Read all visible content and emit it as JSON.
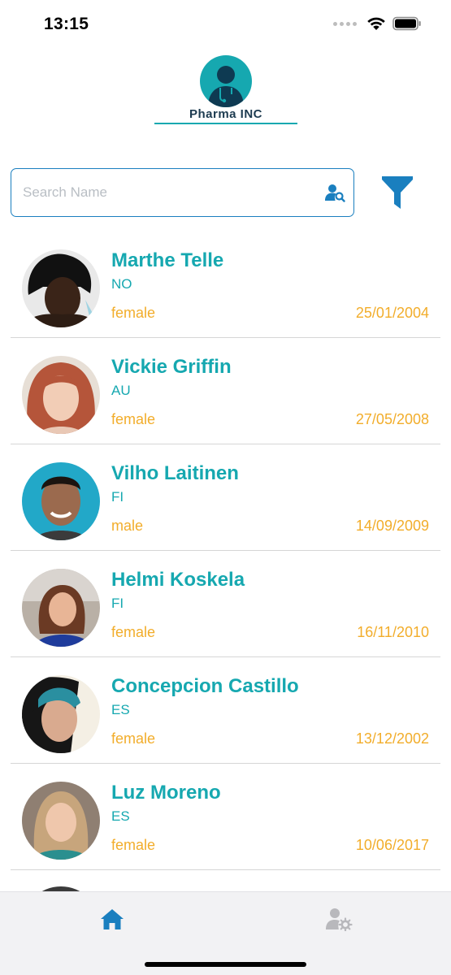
{
  "status_bar": {
    "time": "13:15",
    "icons": [
      "signal-dots-icon",
      "wifi-icon",
      "battery-icon"
    ]
  },
  "logo": {
    "text": "Pharma INC",
    "icon": "doctor-avatar-icon",
    "accent_color": "#16a8b0"
  },
  "search": {
    "value": "",
    "placeholder": "Search Name",
    "icon": "user-search-icon",
    "border_color": "#1a7fbf"
  },
  "filter": {
    "icon": "filter-icon",
    "color": "#1a7fbf"
  },
  "patients": [
    {
      "name": "Marthe Telle",
      "nat": "NO",
      "gender": "female",
      "dob": "25/01/2004"
    },
    {
      "name": "Vickie Griffin",
      "nat": "AU",
      "gender": "female",
      "dob": "27/05/2008"
    },
    {
      "name": "Vilho Laitinen",
      "nat": "FI",
      "gender": "male",
      "dob": "14/09/2009"
    },
    {
      "name": "Helmi Koskela",
      "nat": "FI",
      "gender": "female",
      "dob": "16/11/2010"
    },
    {
      "name": "Concepcion Castillo",
      "nat": "ES",
      "gender": "female",
      "dob": "13/12/2002"
    },
    {
      "name": "Luz Moreno",
      "nat": "ES",
      "gender": "female",
      "dob": "10/06/2017"
    }
  ],
  "colors": {
    "name": "#16a8b0",
    "meta": "#f2ad2b",
    "tab_active": "#1a7fbf",
    "tab_inactive": "#b8b8bc"
  },
  "tab_bar": {
    "tabs": [
      {
        "icon": "home-icon",
        "active": true
      },
      {
        "icon": "user-settings-icon",
        "active": false
      }
    ]
  }
}
